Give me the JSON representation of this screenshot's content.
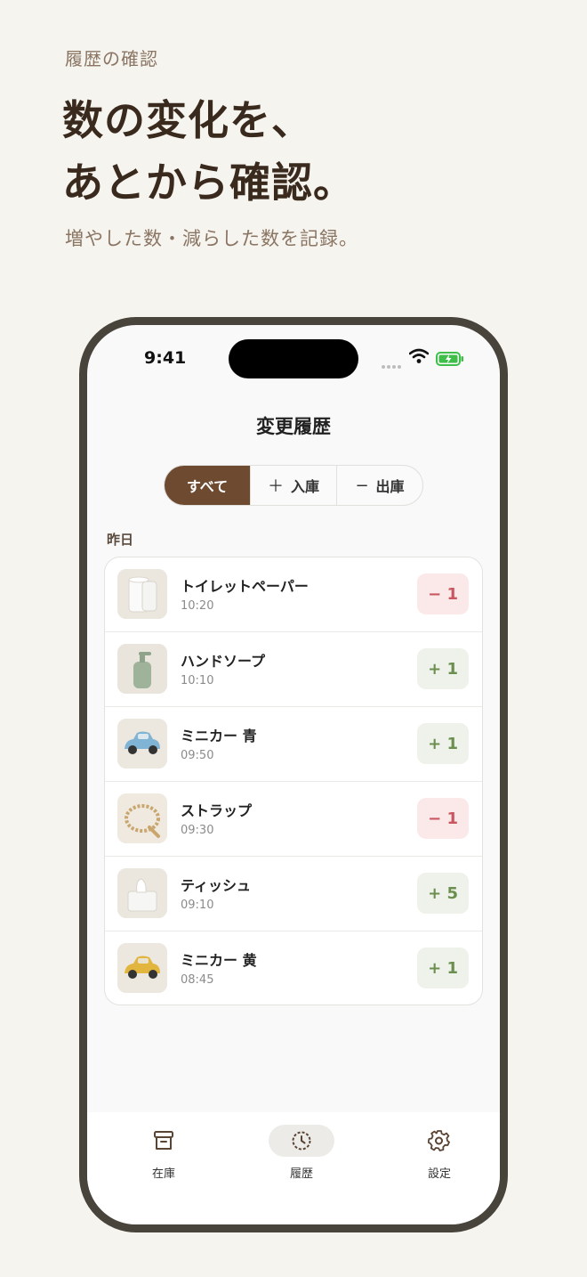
{
  "promo": {
    "eyebrow": "履歴の確認",
    "headline_line1": "数の変化を、",
    "headline_line2": "あとから確認。",
    "subline": "増やした数・減らした数を記録。"
  },
  "status_bar": {
    "time": "9:41"
  },
  "screen": {
    "title": "変更履歴",
    "filters": [
      {
        "label": "すべて",
        "symbol": ""
      },
      {
        "label": "入庫",
        "symbol": "＋"
      },
      {
        "label": "出庫",
        "symbol": "−"
      }
    ],
    "section_label": "昨日",
    "items": [
      {
        "name": "トイレットペーパー",
        "time": "10:20",
        "delta": "− 1",
        "thumb": "toilet-paper-icon"
      },
      {
        "name": "ハンドソープ",
        "time": "10:10",
        "delta": "+ 1",
        "thumb": "hand-soap-icon"
      },
      {
        "name": "ミニカー 青",
        "time": "09:50",
        "delta": "+ 1",
        "thumb": "blue-toy-car-icon"
      },
      {
        "name": "ストラップ",
        "time": "09:30",
        "delta": "− 1",
        "thumb": "strap-icon"
      },
      {
        "name": "ティッシュ",
        "time": "09:10",
        "delta": "+ 5",
        "thumb": "tissue-box-icon"
      },
      {
        "name": "ミニカー 黄",
        "time": "08:45",
        "delta": "+ 1",
        "thumb": "yellow-toy-car-icon"
      }
    ]
  },
  "tabbar": {
    "tabs": [
      {
        "label": "在庫",
        "icon": "archive-box-icon"
      },
      {
        "label": "履歴",
        "icon": "history-clock-icon"
      },
      {
        "label": "設定",
        "icon": "gear-icon"
      }
    ]
  },
  "colors": {
    "background": "#f6f4ef",
    "accent": "#6d4a30",
    "minus_text": "#c9555f",
    "minus_bg": "#fbe9ea",
    "plus_text": "#6b8f4e",
    "plus_bg": "#eef2ea",
    "phone_frame": "#48443c"
  }
}
